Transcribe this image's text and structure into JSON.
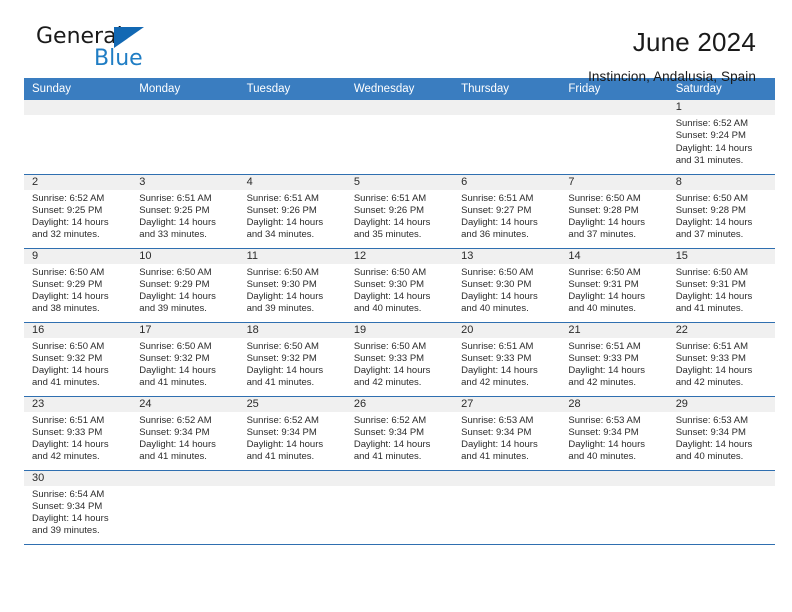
{
  "brand": {
    "name_part1": "General",
    "name_part2": "Blue",
    "flag_icon": "flag-triangle-icon",
    "accent_color": "#1f7dc4"
  },
  "header": {
    "title": "June 2024",
    "subtitle": "Instincion, Andalusia, Spain"
  },
  "theme": {
    "header_row_bg": "#3a7dc0",
    "daynum_bg": "#f0f0f0",
    "grid_line": "#2f6fb0",
    "text": "#2b2b2b"
  },
  "weekdays": [
    "Sunday",
    "Monday",
    "Tuesday",
    "Wednesday",
    "Thursday",
    "Friday",
    "Saturday"
  ],
  "labels": {
    "sunrise_prefix": "Sunrise:",
    "sunset_prefix": "Sunset:",
    "daylight_prefix": "Daylight:"
  },
  "weeks": [
    [
      {
        "blank": true
      },
      {
        "blank": true
      },
      {
        "blank": true
      },
      {
        "blank": true
      },
      {
        "blank": true
      },
      {
        "blank": true
      },
      {
        "day": "1",
        "sunrise": "Sunrise: 6:52 AM",
        "sunset": "Sunset: 9:24 PM",
        "daylight1": "Daylight: 14 hours",
        "daylight2": "and 31 minutes."
      }
    ],
    [
      {
        "day": "2",
        "sunrise": "Sunrise: 6:52 AM",
        "sunset": "Sunset: 9:25 PM",
        "daylight1": "Daylight: 14 hours",
        "daylight2": "and 32 minutes."
      },
      {
        "day": "3",
        "sunrise": "Sunrise: 6:51 AM",
        "sunset": "Sunset: 9:25 PM",
        "daylight1": "Daylight: 14 hours",
        "daylight2": "and 33 minutes."
      },
      {
        "day": "4",
        "sunrise": "Sunrise: 6:51 AM",
        "sunset": "Sunset: 9:26 PM",
        "daylight1": "Daylight: 14 hours",
        "daylight2": "and 34 minutes."
      },
      {
        "day": "5",
        "sunrise": "Sunrise: 6:51 AM",
        "sunset": "Sunset: 9:26 PM",
        "daylight1": "Daylight: 14 hours",
        "daylight2": "and 35 minutes."
      },
      {
        "day": "6",
        "sunrise": "Sunrise: 6:51 AM",
        "sunset": "Sunset: 9:27 PM",
        "daylight1": "Daylight: 14 hours",
        "daylight2": "and 36 minutes."
      },
      {
        "day": "7",
        "sunrise": "Sunrise: 6:50 AM",
        "sunset": "Sunset: 9:28 PM",
        "daylight1": "Daylight: 14 hours",
        "daylight2": "and 37 minutes."
      },
      {
        "day": "8",
        "sunrise": "Sunrise: 6:50 AM",
        "sunset": "Sunset: 9:28 PM",
        "daylight1": "Daylight: 14 hours",
        "daylight2": "and 37 minutes."
      }
    ],
    [
      {
        "day": "9",
        "sunrise": "Sunrise: 6:50 AM",
        "sunset": "Sunset: 9:29 PM",
        "daylight1": "Daylight: 14 hours",
        "daylight2": "and 38 minutes."
      },
      {
        "day": "10",
        "sunrise": "Sunrise: 6:50 AM",
        "sunset": "Sunset: 9:29 PM",
        "daylight1": "Daylight: 14 hours",
        "daylight2": "and 39 minutes."
      },
      {
        "day": "11",
        "sunrise": "Sunrise: 6:50 AM",
        "sunset": "Sunset: 9:30 PM",
        "daylight1": "Daylight: 14 hours",
        "daylight2": "and 39 minutes."
      },
      {
        "day": "12",
        "sunrise": "Sunrise: 6:50 AM",
        "sunset": "Sunset: 9:30 PM",
        "daylight1": "Daylight: 14 hours",
        "daylight2": "and 40 minutes."
      },
      {
        "day": "13",
        "sunrise": "Sunrise: 6:50 AM",
        "sunset": "Sunset: 9:30 PM",
        "daylight1": "Daylight: 14 hours",
        "daylight2": "and 40 minutes."
      },
      {
        "day": "14",
        "sunrise": "Sunrise: 6:50 AM",
        "sunset": "Sunset: 9:31 PM",
        "daylight1": "Daylight: 14 hours",
        "daylight2": "and 40 minutes."
      },
      {
        "day": "15",
        "sunrise": "Sunrise: 6:50 AM",
        "sunset": "Sunset: 9:31 PM",
        "daylight1": "Daylight: 14 hours",
        "daylight2": "and 41 minutes."
      }
    ],
    [
      {
        "day": "16",
        "sunrise": "Sunrise: 6:50 AM",
        "sunset": "Sunset: 9:32 PM",
        "daylight1": "Daylight: 14 hours",
        "daylight2": "and 41 minutes."
      },
      {
        "day": "17",
        "sunrise": "Sunrise: 6:50 AM",
        "sunset": "Sunset: 9:32 PM",
        "daylight1": "Daylight: 14 hours",
        "daylight2": "and 41 minutes."
      },
      {
        "day": "18",
        "sunrise": "Sunrise: 6:50 AM",
        "sunset": "Sunset: 9:32 PM",
        "daylight1": "Daylight: 14 hours",
        "daylight2": "and 41 minutes."
      },
      {
        "day": "19",
        "sunrise": "Sunrise: 6:50 AM",
        "sunset": "Sunset: 9:33 PM",
        "daylight1": "Daylight: 14 hours",
        "daylight2": "and 42 minutes."
      },
      {
        "day": "20",
        "sunrise": "Sunrise: 6:51 AM",
        "sunset": "Sunset: 9:33 PM",
        "daylight1": "Daylight: 14 hours",
        "daylight2": "and 42 minutes."
      },
      {
        "day": "21",
        "sunrise": "Sunrise: 6:51 AM",
        "sunset": "Sunset: 9:33 PM",
        "daylight1": "Daylight: 14 hours",
        "daylight2": "and 42 minutes."
      },
      {
        "day": "22",
        "sunrise": "Sunrise: 6:51 AM",
        "sunset": "Sunset: 9:33 PM",
        "daylight1": "Daylight: 14 hours",
        "daylight2": "and 42 minutes."
      }
    ],
    [
      {
        "day": "23",
        "sunrise": "Sunrise: 6:51 AM",
        "sunset": "Sunset: 9:33 PM",
        "daylight1": "Daylight: 14 hours",
        "daylight2": "and 42 minutes."
      },
      {
        "day": "24",
        "sunrise": "Sunrise: 6:52 AM",
        "sunset": "Sunset: 9:34 PM",
        "daylight1": "Daylight: 14 hours",
        "daylight2": "and 41 minutes."
      },
      {
        "day": "25",
        "sunrise": "Sunrise: 6:52 AM",
        "sunset": "Sunset: 9:34 PM",
        "daylight1": "Daylight: 14 hours",
        "daylight2": "and 41 minutes."
      },
      {
        "day": "26",
        "sunrise": "Sunrise: 6:52 AM",
        "sunset": "Sunset: 9:34 PM",
        "daylight1": "Daylight: 14 hours",
        "daylight2": "and 41 minutes."
      },
      {
        "day": "27",
        "sunrise": "Sunrise: 6:53 AM",
        "sunset": "Sunset: 9:34 PM",
        "daylight1": "Daylight: 14 hours",
        "daylight2": "and 41 minutes."
      },
      {
        "day": "28",
        "sunrise": "Sunrise: 6:53 AM",
        "sunset": "Sunset: 9:34 PM",
        "daylight1": "Daylight: 14 hours",
        "daylight2": "and 40 minutes."
      },
      {
        "day": "29",
        "sunrise": "Sunrise: 6:53 AM",
        "sunset": "Sunset: 9:34 PM",
        "daylight1": "Daylight: 14 hours",
        "daylight2": "and 40 minutes."
      }
    ],
    [
      {
        "day": "30",
        "sunrise": "Sunrise: 6:54 AM",
        "sunset": "Sunset: 9:34 PM",
        "daylight1": "Daylight: 14 hours",
        "daylight2": "and 39 minutes."
      },
      {
        "blank": true
      },
      {
        "blank": true
      },
      {
        "blank": true
      },
      {
        "blank": true
      },
      {
        "blank": true
      },
      {
        "blank": true
      }
    ]
  ]
}
